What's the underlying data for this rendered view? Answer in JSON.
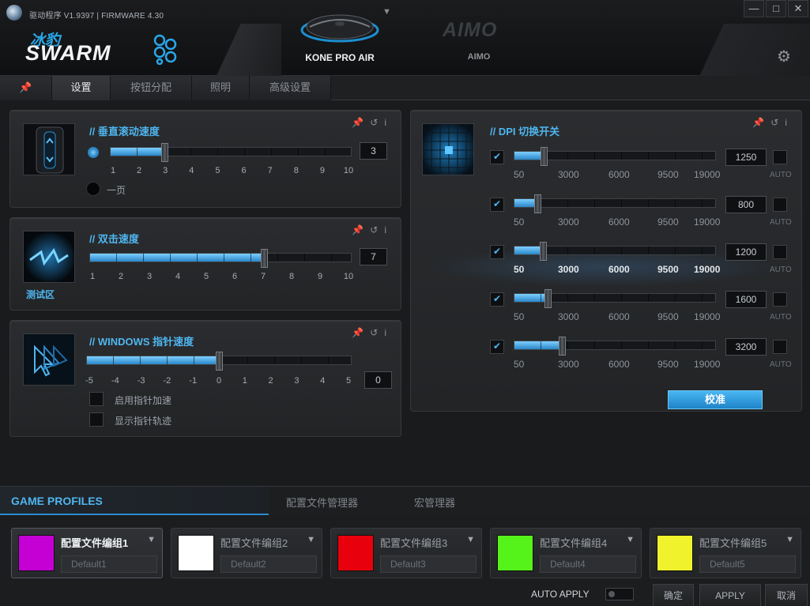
{
  "title_bar": {
    "text": "驱动程序 V1.9397 | FIRMWARE 4.30"
  },
  "logo": {
    "cn": "冰豹",
    "en": "SWARM"
  },
  "devices": [
    {
      "name": "KONE PRO AIR"
    },
    {
      "name": "AIMO",
      "logo_text": "AIMO"
    }
  ],
  "window_controls": {
    "minimize": "—",
    "restore": "□",
    "close": "✕"
  },
  "tabs": [
    {
      "label": "设置"
    },
    {
      "label": "按钮分配"
    },
    {
      "label": "照明"
    },
    {
      "label": "高级设置"
    }
  ],
  "scroll_panel": {
    "title": "// 垂直滚动速度",
    "ticks": [
      "1",
      "2",
      "3",
      "4",
      "5",
      "6",
      "7",
      "8",
      "9",
      "10"
    ],
    "value": "3",
    "level": 3,
    "max": 10,
    "one_page_label": "一页"
  },
  "dblclick_panel": {
    "title": "// 双击速度",
    "ticks": [
      "1",
      "2",
      "3",
      "4",
      "5",
      "6",
      "7",
      "8",
      "9",
      "10"
    ],
    "value": "7",
    "level": 7,
    "max": 10,
    "test_area_label": "测试区"
  },
  "pointer_panel": {
    "title": "// WINDOWS 指针速度",
    "ticks": [
      "-5",
      "-4",
      "-3",
      "-2",
      "-1",
      "0",
      "1",
      "2",
      "3",
      "4",
      "5"
    ],
    "value": "0",
    "level": 0,
    "accel_label": "启用指针加速",
    "trail_label": "显示指针轨迹"
  },
  "dpi_panel": {
    "title": "// DPI 切换开关",
    "ticks": [
      "50",
      "3000",
      "6000",
      "9500",
      "19000"
    ],
    "auto_label": "AUTO",
    "calibrate_label": "校准",
    "levels": [
      {
        "value": "1250",
        "dpi": 1250,
        "enabled": true
      },
      {
        "value": "800",
        "dpi": 800,
        "enabled": true
      },
      {
        "value": "1200",
        "dpi": 1200,
        "enabled": true,
        "active": true
      },
      {
        "value": "1600",
        "dpi": 1600,
        "enabled": true
      },
      {
        "value": "3200",
        "dpi": 3200,
        "enabled": true
      }
    ]
  },
  "profile_tabs": {
    "game": "GAME PROFILES",
    "manager": "配置文件管理器",
    "macro": "宏管理器"
  },
  "profiles": [
    {
      "name": "配置文件编组1",
      "field": "Default1",
      "color": "#c400d4",
      "active": true
    },
    {
      "name": "配置文件编组2",
      "field": "Default2",
      "color": "#ffffff"
    },
    {
      "name": "配置文件编组3",
      "field": "Default3",
      "color": "#e8000d"
    },
    {
      "name": "配置文件编组4",
      "field": "Default4",
      "color": "#55f31a"
    },
    {
      "name": "配置文件编组5",
      "field": "Default5",
      "color": "#f0f32c"
    }
  ],
  "footer": {
    "auto_apply": "AUTO APPLY",
    "ok": "确定",
    "apply": "APPLY",
    "cancel": "取消"
  },
  "colors": {
    "accent": "#4fb6ef",
    "calibrate": "#2a8ccf"
  }
}
